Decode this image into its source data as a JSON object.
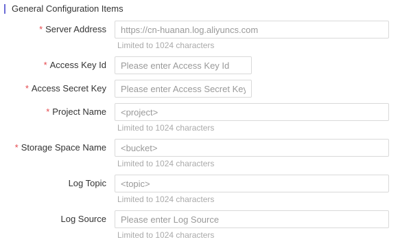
{
  "section": {
    "title": "General Configuration Items"
  },
  "colors": {
    "accent_bar": "#6b6bd6",
    "required_star": "#e5484d",
    "hint_text": "#aaaaaa",
    "placeholder_text": "#999999",
    "input_border": "#d9d9d9"
  },
  "fields": {
    "server_address": {
      "label": "Server Address",
      "required": "*",
      "placeholder": "https://cn-huanan.log.aliyuncs.com",
      "hint": "Limited to 1024 characters"
    },
    "access_key_id": {
      "label": "Access Key Id",
      "required": "*",
      "placeholder": "Please enter Access Key Id"
    },
    "access_secret_key": {
      "label": "Access Secret Key",
      "required": "*",
      "placeholder": "Please enter Access Secret Key"
    },
    "project_name": {
      "label": "Project Name",
      "required": "*",
      "placeholder": "<project>",
      "hint": "Limited to 1024 characters"
    },
    "storage_space_name": {
      "label": "Storage Space Name",
      "required": "*",
      "placeholder": "<bucket>",
      "hint": "Limited to 1024 characters"
    },
    "log_topic": {
      "label": "Log Topic",
      "placeholder": "<topic>",
      "hint": "Limited to 1024 characters"
    },
    "log_source": {
      "label": "Log Source",
      "placeholder": "Please enter Log Source",
      "hint": "Limited to 1024 characters"
    }
  }
}
